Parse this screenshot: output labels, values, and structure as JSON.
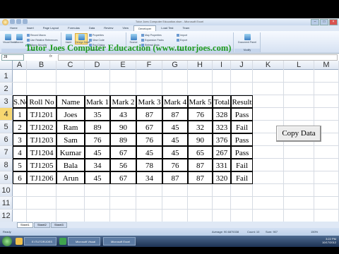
{
  "window": {
    "title": "Tutor Joes Computer Education.xlsm - Microsoft Excel"
  },
  "ribbon_tabs": [
    "Home",
    "Insert",
    "Page Layout",
    "Formulas",
    "Data",
    "Review",
    "View",
    "Developer",
    "Load Test",
    "Team"
  ],
  "active_tab": "Developer",
  "ribbon": {
    "visual_basic": "Visual Basic",
    "macros": "Macros",
    "record_macro": "Record Macro",
    "relative_refs": "Use Relative References",
    "macro_security": "Macro Security",
    "group_code": "Code",
    "insert": "Insert",
    "design_mode": "Design Mode",
    "properties": "Properties",
    "view_code": "View Code",
    "run_dialog": "Run Dialog",
    "group_controls": "Controls",
    "source": "Source",
    "map_properties": "Map Properties",
    "expansion_packs": "Expansion Packs",
    "refresh_data": "Refresh Data",
    "import": "Import",
    "export": "Export",
    "group_xml": "XML",
    "document_panel": "Document Panel",
    "group_modify": "Modify"
  },
  "formula_bar": {
    "name_box": "J9",
    "fx": "fx",
    "value": ""
  },
  "columns": [
    "A",
    "B",
    "C",
    "D",
    "E",
    "F",
    "G",
    "H",
    "I",
    "J",
    "K",
    "L",
    "M"
  ],
  "rows": [
    "1",
    "2",
    "3",
    "4",
    "5",
    "6",
    "7",
    "8",
    "9",
    "10",
    "11",
    "12",
    "13"
  ],
  "heading": "Tutor Joes Computer Educaction (www.tutorjoes.com)",
  "table": {
    "headers": [
      "S.No",
      "Roll No",
      "Name",
      "Mark 1",
      "Mark 2",
      "Mark 3",
      "Mark 4",
      "Mark 5",
      "Total",
      "Result"
    ],
    "rows": [
      [
        "1",
        "TJ1201",
        "Joes",
        "35",
        "43",
        "87",
        "87",
        "76",
        "328",
        "Pass"
      ],
      [
        "2",
        "TJ1202",
        "Ram",
        "89",
        "90",
        "67",
        "45",
        "32",
        "323",
        "Fail"
      ],
      [
        "3",
        "TJ1203",
        "Sam",
        "76",
        "89",
        "76",
        "45",
        "90",
        "376",
        "Pass"
      ],
      [
        "4",
        "TJ1204",
        "Kumar",
        "45",
        "67",
        "45",
        "45",
        "65",
        "267",
        "Pass"
      ],
      [
        "5",
        "TJ1205",
        "Bala",
        "34",
        "56",
        "78",
        "76",
        "87",
        "331",
        "Fail"
      ],
      [
        "6",
        "TJ1206",
        "Arun",
        "45",
        "67",
        "34",
        "87",
        "87",
        "320",
        "Fail"
      ]
    ]
  },
  "copy_button": "Copy Data",
  "sheets": [
    "Sheet1",
    "Sheet2",
    "Sheet3"
  ],
  "status": {
    "ready": "Ready",
    "average": "Average: 90.6875338",
    "count": "Count: 10",
    "sum": "Sum: 907",
    "zoom": "150%"
  },
  "taskbar": {
    "items": [
      "E:\\TUTORJOES",
      "Microsoft Visual",
      "Microsoft Excel"
    ],
    "time": "3:22 PM",
    "date": "10/17/2012"
  },
  "colors": {
    "heading": "#1f9a1f",
    "selected_row": "#f7d770"
  }
}
